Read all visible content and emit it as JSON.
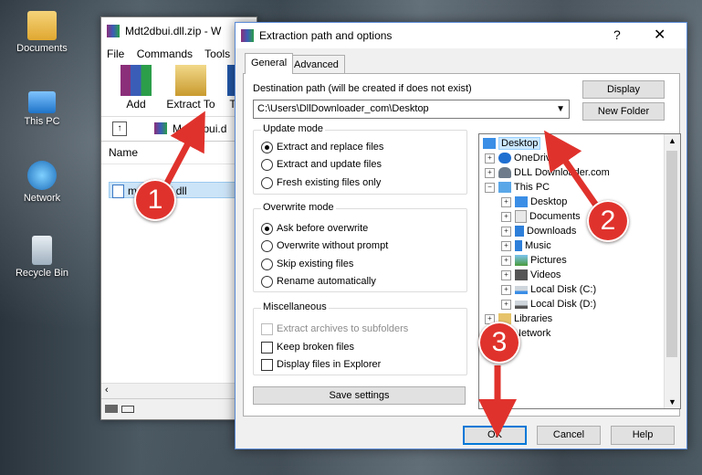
{
  "desktop": {
    "icons": [
      {
        "label": "Documents"
      },
      {
        "label": "This PC"
      },
      {
        "label": "Network"
      },
      {
        "label": "Recycle Bin"
      }
    ]
  },
  "winrar": {
    "title": "Mdt2dbui.dll.zip - W",
    "menu": [
      "File",
      "Commands",
      "Tools"
    ],
    "toolbar": {
      "add": "Add",
      "extract_to": "Extract To",
      "third": "T"
    },
    "address": "Mdt2dbui.d",
    "column_name": "Name",
    "file": "mdt2dbui.dll"
  },
  "dialog": {
    "title": "Extraction path and options",
    "help": "?",
    "close": "✕",
    "tabs": [
      "General",
      "Advanced"
    ],
    "dest_label": "Destination path (will be created if does not exist)",
    "dest_value": "C:\\Users\\DllDownloader_com\\Desktop",
    "display_btn": "Display",
    "new_folder_btn": "New Folder",
    "update_mode": {
      "title": "Update mode",
      "options": [
        "Extract and replace files",
        "Extract and update files",
        "Fresh existing files only"
      ],
      "selected": 0
    },
    "overwrite_mode": {
      "title": "Overwrite mode",
      "options": [
        "Ask before overwrite",
        "Overwrite without prompt",
        "Skip existing files",
        "Rename automatically"
      ],
      "selected": 0
    },
    "misc": {
      "title": "Miscellaneous",
      "options": [
        "Extract archives to subfolders",
        "Keep broken files",
        "Display files in Explorer"
      ]
    },
    "save_settings": "Save settings",
    "tree": [
      {
        "label": "Desktop",
        "level": 0,
        "selected": true
      },
      {
        "label": "OneDrive",
        "level": 1
      },
      {
        "label": "DLL Downloader.com",
        "level": 1
      },
      {
        "label": "This PC",
        "level": 1
      },
      {
        "label": "Desktop",
        "level": 2
      },
      {
        "label": "Documents",
        "level": 2
      },
      {
        "label": "Downloads",
        "level": 2
      },
      {
        "label": "Music",
        "level": 2
      },
      {
        "label": "Pictures",
        "level": 2
      },
      {
        "label": "Videos",
        "level": 2
      },
      {
        "label": "Local Disk (C:)",
        "level": 2
      },
      {
        "label": "Local Disk (D:)",
        "level": 2
      },
      {
        "label": "Libraries",
        "level": 1
      },
      {
        "label": "Network",
        "level": 1
      }
    ],
    "ok": "OK",
    "cancel": "Cancel",
    "help_btn": "Help"
  },
  "callouts": [
    "1",
    "2",
    "3"
  ],
  "colors": {
    "callout": "#e0322c",
    "selection": "#cce8ff",
    "accent": "#0078d7"
  }
}
